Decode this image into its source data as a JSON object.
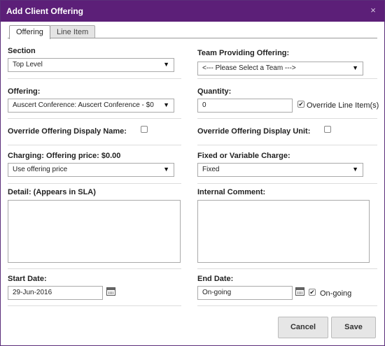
{
  "window": {
    "title": "Add Client Offering",
    "close_icon": "×"
  },
  "tabs": [
    {
      "label": "Offering"
    },
    {
      "label": "Line Item"
    }
  ],
  "form": {
    "section": {
      "label": "Section",
      "value": "Top Level"
    },
    "team": {
      "label": "Team Providing Offering:",
      "value": "<--- Please Select a Team --->"
    },
    "offering": {
      "label": "Offering:",
      "value": "Auscert Conference: Auscert Conference - $0"
    },
    "quantity": {
      "label": "Quantity:",
      "value": "0",
      "override_label": "Override Line Item(s)",
      "override_checked": true
    },
    "override_name": {
      "label": "Override Offering Dispaly Name:",
      "checked": false
    },
    "override_unit": {
      "label": "Override Offering Display Unit:",
      "checked": false
    },
    "charging": {
      "label": "Charging: Offering price: $0.00",
      "value": "Use offering price"
    },
    "fixed_variable": {
      "label": "Fixed or Variable Charge:",
      "value": "Fixed"
    },
    "detail": {
      "label": "Detail: (Appears in SLA)",
      "value": ""
    },
    "internal_comment": {
      "label": "Internal Comment:",
      "value": ""
    },
    "start_date": {
      "label": "Start Date:",
      "value": "29-Jun-2016"
    },
    "end_date": {
      "label": "End Date:",
      "value": "On-going",
      "ongoing_label": "On-going",
      "ongoing_checked": true
    }
  },
  "buttons": {
    "cancel": "Cancel",
    "save": "Save"
  },
  "icons": {
    "dropdown": "chevron-down-icon",
    "calendar": "calendar-icon",
    "checkmark": "✔"
  }
}
